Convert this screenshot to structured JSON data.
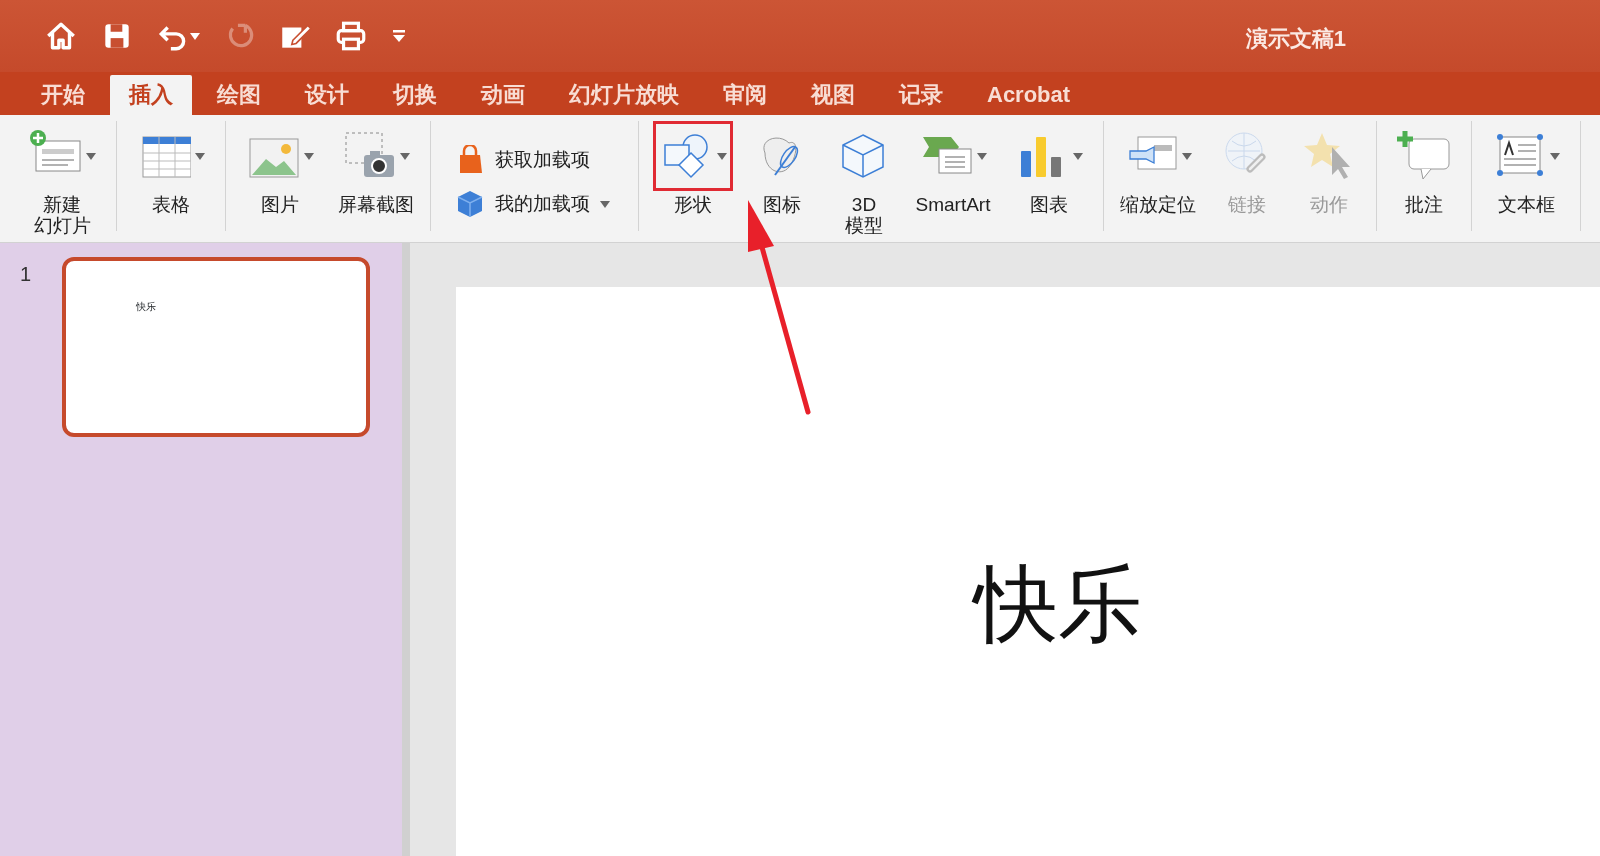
{
  "window": {
    "title": "演示文稿1"
  },
  "quick_access": [
    {
      "disabled": false
    },
    {
      "disabled": false
    },
    {
      "disabled": false
    },
    {
      "disabled": true
    },
    {
      "disabled": false
    },
    {
      "disabled": false
    },
    {
      "disabled": false
    }
  ],
  "tabs": [
    {
      "label": "开始",
      "selected": false
    },
    {
      "label": "插入",
      "selected": true
    },
    {
      "label": "绘图",
      "selected": false
    },
    {
      "label": "设计",
      "selected": false
    },
    {
      "label": "切换",
      "selected": false
    },
    {
      "label": "动画",
      "selected": false
    },
    {
      "label": "幻灯片放映",
      "selected": false
    },
    {
      "label": "审阅",
      "selected": false
    },
    {
      "label": "视图",
      "selected": false
    },
    {
      "label": "记录",
      "selected": false
    },
    {
      "label": "Acrobat",
      "selected": false
    }
  ],
  "ribbon": {
    "groups": [
      {
        "kind": "buttons",
        "items": [
          {
            "lines": [
              "新建",
              "幻灯片"
            ],
            "has_dropdown": true,
            "disabled": false,
            "highlighted": false
          }
        ]
      },
      {
        "kind": "buttons",
        "items": [
          {
            "label": "表格",
            "has_dropdown": true,
            "disabled": false,
            "highlighted": false
          }
        ]
      },
      {
        "kind": "buttons",
        "items": [
          {
            "label": "图片",
            "has_dropdown": true,
            "disabled": false,
            "highlighted": false
          },
          {
            "label": "屏幕截图",
            "has_dropdown": true,
            "disabled": false,
            "highlighted": false
          }
        ]
      },
      {
        "kind": "list",
        "items": [
          {
            "label": "获取加载项",
            "has_dropdown": false,
            "disabled": false,
            "highlighted": false
          },
          {
            "label": "我的加载项",
            "has_dropdown": true,
            "disabled": false,
            "highlighted": false
          }
        ]
      },
      {
        "kind": "buttons",
        "items": [
          {
            "label": "形状",
            "has_dropdown": true,
            "disabled": false,
            "highlighted": true
          },
          {
            "label": "图标",
            "has_dropdown": false,
            "disabled": false,
            "highlighted": false
          },
          {
            "lines": [
              "3D",
              "模型"
            ],
            "has_dropdown": false,
            "disabled": false,
            "highlighted": false
          },
          {
            "label": "SmartArt",
            "has_dropdown": true,
            "disabled": false,
            "highlighted": false
          },
          {
            "label": "图表",
            "has_dropdown": true,
            "disabled": false,
            "highlighted": false
          }
        ]
      },
      {
        "kind": "buttons",
        "items": [
          {
            "label": "缩放定位",
            "has_dropdown": true,
            "disabled": false,
            "highlighted": false
          },
          {
            "label": "链接",
            "has_dropdown": false,
            "disabled": true,
            "highlighted": false
          },
          {
            "label": "动作",
            "has_dropdown": false,
            "disabled": true,
            "highlighted": false
          }
        ]
      },
      {
        "kind": "buttons",
        "items": [
          {
            "label": "批注",
            "has_dropdown": false,
            "disabled": false,
            "highlighted": false
          }
        ]
      },
      {
        "kind": "buttons",
        "items": [
          {
            "label": "文本框",
            "has_dropdown": true,
            "disabled": false,
            "highlighted": false
          }
        ]
      }
    ]
  },
  "slides_panel": [
    {
      "number": "1",
      "selected": true,
      "text": "快乐"
    }
  ],
  "slide": {
    "text": "快乐"
  },
  "annotation": {
    "arrow": true
  }
}
